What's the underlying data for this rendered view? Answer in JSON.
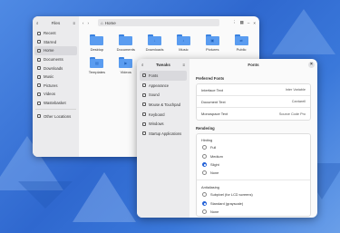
{
  "colors": {
    "accent": "#2563d8",
    "folder": "#5a9cf0",
    "wallpaper": "#2f6fd0"
  },
  "files": {
    "title": "Files",
    "path": "Home",
    "sidebar": [
      {
        "label": "Recent",
        "icon": "clock-icon"
      },
      {
        "label": "Starred",
        "icon": "star-icon"
      },
      {
        "label": "Home",
        "icon": "home-icon",
        "active": true
      },
      {
        "label": "Documents",
        "icon": "document-icon"
      },
      {
        "label": "Downloads",
        "icon": "download-icon"
      },
      {
        "label": "Music",
        "icon": "music-icon"
      },
      {
        "label": "Pictures",
        "icon": "image-icon"
      },
      {
        "label": "Videos",
        "icon": "video-icon"
      },
      {
        "label": "Wastebasket",
        "icon": "trash-icon"
      }
    ],
    "other_locations": "Other Locations",
    "folders": [
      "Desktop",
      "Documents",
      "Downloads",
      "Music",
      "Pictures",
      "Public",
      "Templates",
      "Videos"
    ]
  },
  "tweaks": {
    "title": "Tweaks",
    "page_title": "Fonts",
    "sidebar": [
      {
        "label": "Fonts",
        "icon": "font-icon",
        "active": true
      },
      {
        "label": "Appearance",
        "icon": "palette-icon"
      },
      {
        "label": "Sound",
        "icon": "speaker-icon"
      },
      {
        "label": "Mouse & Touchpad",
        "icon": "mouse-icon"
      },
      {
        "label": "Keyboard",
        "icon": "keyboard-icon"
      },
      {
        "label": "Windows",
        "icon": "window-icon"
      },
      {
        "label": "Startup Applications",
        "icon": "rocket-icon"
      }
    ],
    "preferred_fonts": {
      "title": "Preferred Fonts",
      "rows": [
        {
          "label": "Interface Text",
          "value": "Inter Variable"
        },
        {
          "label": "Document Text",
          "value": "Cantarell"
        },
        {
          "label": "Monospace Text",
          "value": "Source Code Pro"
        }
      ]
    },
    "rendering": {
      "title": "Rendering",
      "hinting_title": "Hinting",
      "hinting": [
        {
          "label": "Full",
          "selected": false
        },
        {
          "label": "Medium",
          "selected": false
        },
        {
          "label": "Slight",
          "selected": true
        },
        {
          "label": "None",
          "selected": false
        }
      ],
      "antialiasing_title": "Antialiasing",
      "antialiasing": [
        {
          "label": "Subpixel (for LCD screens)",
          "selected": false
        },
        {
          "label": "Standard (grayscale)",
          "selected": true
        },
        {
          "label": "None",
          "selected": false
        }
      ]
    }
  }
}
